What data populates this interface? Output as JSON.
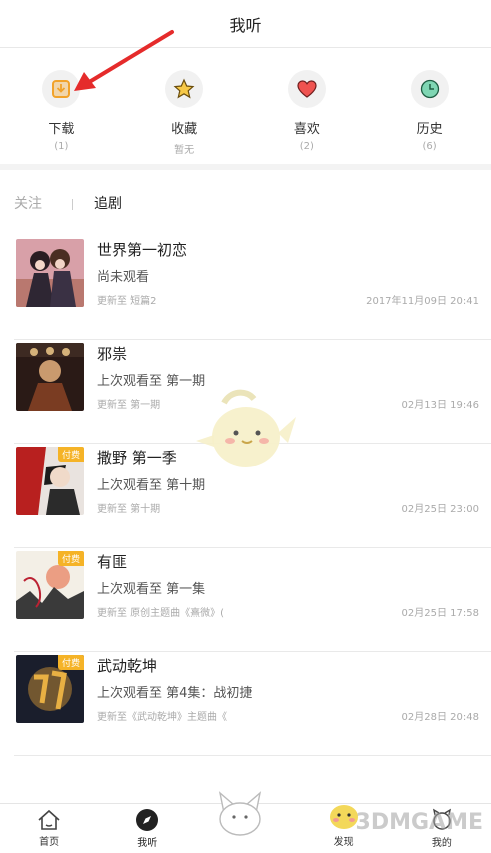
{
  "header": {
    "title": "我听"
  },
  "quick": [
    {
      "label": "下载",
      "count": "(1)",
      "icon": "download-icon",
      "color": "#f2a32c"
    },
    {
      "label": "收藏",
      "count": "暂无",
      "icon": "star-icon",
      "color": "#f5c02c"
    },
    {
      "label": "喜欢",
      "count": "(2)",
      "icon": "heart-icon",
      "color": "#ef5350"
    },
    {
      "label": "历史",
      "count": "(6)",
      "icon": "clock-icon",
      "color": "#2bb57a"
    }
  ],
  "tabs": {
    "follow": "关注",
    "drama": "追剧"
  },
  "list": [
    {
      "title": "世界第一初恋",
      "subtitle": "尚未观看",
      "update": "更新至 短篇2",
      "date": "2017年11月09日 20:41",
      "paid": ""
    },
    {
      "title": "邪祟",
      "subtitle": "上次观看至 第一期",
      "update": "更新至 第一期",
      "date": "02月13日 19:46",
      "paid": ""
    },
    {
      "title": "撒野 第一季",
      "subtitle": "上次观看至 第十期",
      "update": "更新至 第十期",
      "date": "02月25日 23:00",
      "paid": "付费"
    },
    {
      "title": "有匪",
      "subtitle": "上次观看至 第一集",
      "update": "更新至 原创主题曲《熹微》(",
      "date": "02月25日 17:58",
      "paid": "付费"
    },
    {
      "title": "武动乾坤",
      "subtitle": "上次观看至 第4集：战初捷",
      "update": "更新至《武动乾坤》主题曲《",
      "date": "02月28日 20:48",
      "paid": "付费"
    }
  ],
  "nav": {
    "home": "首页",
    "mine_listen": "我听",
    "discover": "发现",
    "me": "我的"
  },
  "watermark": "3DMGAME",
  "colors": {
    "arrow": "#e52b2b",
    "paid_badge": "#f5b327"
  }
}
